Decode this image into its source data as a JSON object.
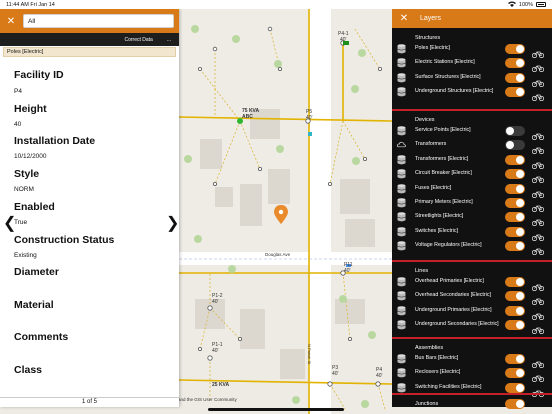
{
  "status_bar": {
    "time": "11:44 AM",
    "date": "Fri Jan 14",
    "battery": "100%"
  },
  "search": {
    "value": "All"
  },
  "toolbar": {
    "correct_data": "Correct Data",
    "more": "..."
  },
  "selected_layer": "Poles [Electric]",
  "fields": [
    {
      "label": "Facility ID",
      "value": "P4"
    },
    {
      "label": "Height",
      "value": "40"
    },
    {
      "label": "Installation Date",
      "value": "10/12/2000"
    },
    {
      "label": "Style",
      "value": "NORM"
    },
    {
      "label": "Enabled",
      "value": "True"
    },
    {
      "label": "Construction Status",
      "value": "Existing"
    },
    {
      "label": "Diameter",
      "value": ""
    },
    {
      "label": "Material",
      "value": ""
    },
    {
      "label": "Comments",
      "value": ""
    },
    {
      "label": "Class",
      "value": ""
    }
  ],
  "pager": "1 of 5",
  "layers_panel": {
    "title": "Layers",
    "sections": [
      {
        "title": "Structures",
        "items": [
          {
            "label": "Poles [Electric]",
            "icon": "database-icon",
            "on": true
          },
          {
            "label": "Electric Stations [Electric]",
            "icon": "database-icon",
            "on": true
          },
          {
            "label": "Surface Structures [Electric]",
            "icon": "database-icon",
            "on": true
          },
          {
            "label": "Underground Structures [Electric]",
            "icon": "database-icon",
            "on": true
          }
        ]
      },
      {
        "title": "Devices",
        "items": [
          {
            "label": "Service Points [Electric]",
            "icon": "database-icon",
            "on": false
          },
          {
            "label": "Transformers",
            "icon": "cloud-icon",
            "on": false
          },
          {
            "label": "Transformers [Electric]",
            "icon": "database-icon",
            "on": true
          },
          {
            "label": "Circuit Breaker [Electric]",
            "icon": "database-icon",
            "on": true
          },
          {
            "label": "Fuses [Electric]",
            "icon": "database-icon",
            "on": true
          },
          {
            "label": "Primary Meters [Electric]",
            "icon": "database-icon",
            "on": true
          },
          {
            "label": "Streetlights [Electric]",
            "icon": "database-icon",
            "on": true
          },
          {
            "label": "Switches [Electric]",
            "icon": "database-icon",
            "on": true
          },
          {
            "label": "Voltage Regulators [Electric]",
            "icon": "database-icon",
            "on": true
          }
        ]
      },
      {
        "title": "Lines",
        "items": [
          {
            "label": "Overhead Primaries [Electric]",
            "icon": "database-icon",
            "on": true
          },
          {
            "label": "Overhead Secondaries [Electric]",
            "icon": "database-icon",
            "on": true
          },
          {
            "label": "Underground Primaries [Electric]",
            "icon": "database-icon",
            "on": true
          },
          {
            "label": "Underground Secondaries [Electric]",
            "icon": "database-icon",
            "on": true
          }
        ]
      },
      {
        "title": "Assemblies",
        "items": [
          {
            "label": "Bus Bars [Electric]",
            "icon": "database-icon",
            "on": true
          },
          {
            "label": "Reclosers [Electric]",
            "icon": "database-icon",
            "on": true
          },
          {
            "label": "Switching Facilities [Electric]",
            "icon": "database-icon",
            "on": true
          }
        ]
      },
      {
        "title": "Junctions",
        "items": []
      }
    ]
  },
  "map": {
    "labels": {
      "transformer_top": "75 KVA",
      "transformer_top_b": "ABC",
      "transformer_bottom": "25 KVA",
      "street": "Douglas Ave",
      "street_v": "N Parish St",
      "p41": "P4-1",
      "p41_h": "40'",
      "p5": "P5",
      "p5_h": "40'",
      "p6": "P6",
      "p6_h": "40'",
      "p11": "P11",
      "p11_h": "40'",
      "p12": "P1-2",
      "p12_h": "40'",
      "p11b": "P1-1",
      "p11b_h": "40'",
      "p3": "P3",
      "p3_h": "40'",
      "p4": "P4",
      "p4_h": "40'"
    },
    "attribution": "and the GIS User Community"
  },
  "colors": {
    "accent": "#d97a18",
    "divider": "#c4202a",
    "line": "#e2b300"
  }
}
